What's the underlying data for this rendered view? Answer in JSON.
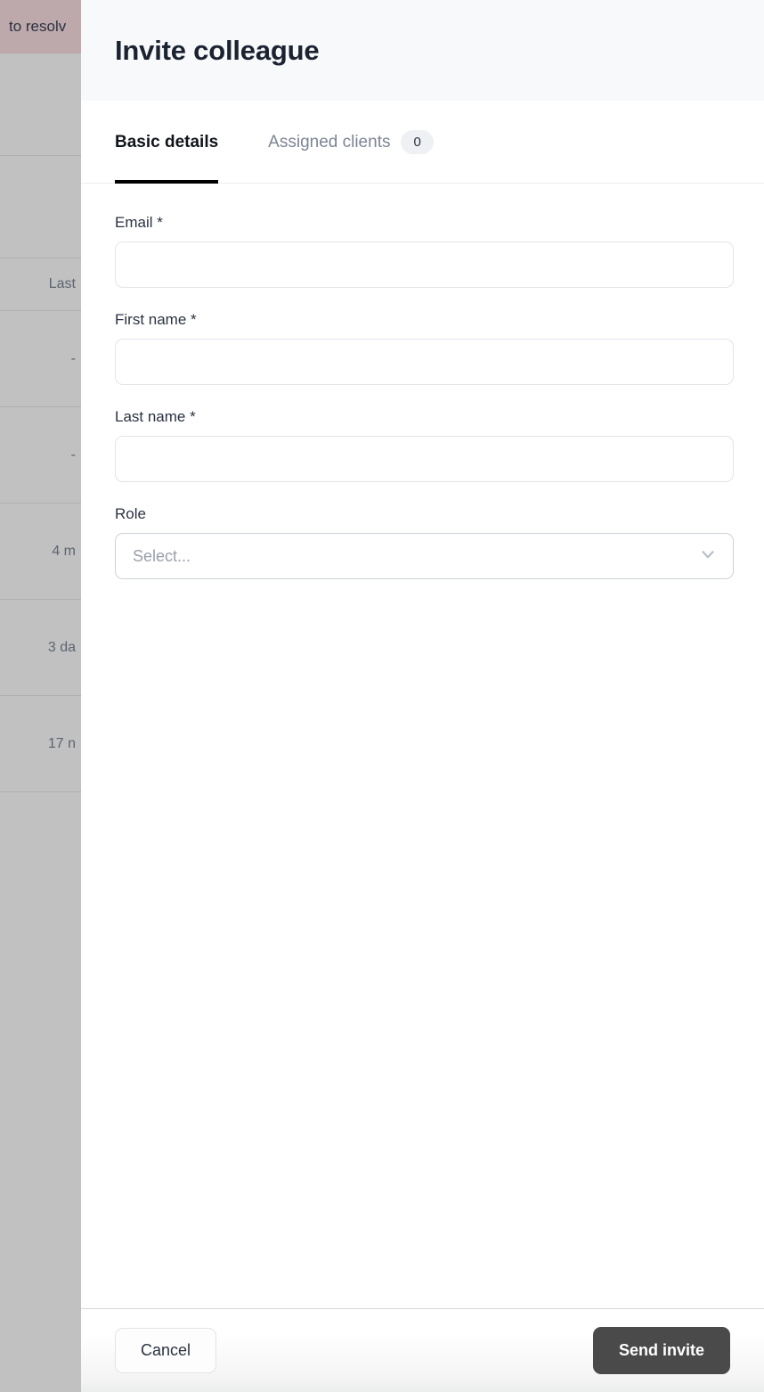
{
  "backdrop": {
    "banner_text": "to resolv",
    "rows": [
      {
        "text": ""
      },
      {
        "text": ""
      },
      {
        "text": "Last"
      },
      {
        "text": "-"
      },
      {
        "text": "-"
      },
      {
        "text": "4 m"
      },
      {
        "text": "3 da"
      },
      {
        "text": "17 n"
      }
    ]
  },
  "panel": {
    "title": "Invite colleague",
    "tabs": [
      {
        "label": "Basic details",
        "badge": null,
        "active": true
      },
      {
        "label": "Assigned clients",
        "badge": "0",
        "active": false
      }
    ],
    "fields": [
      {
        "label": "Email *",
        "value": "",
        "placeholder": ""
      },
      {
        "label": "First name *",
        "value": "",
        "placeholder": ""
      },
      {
        "label": "Last name *",
        "value": "",
        "placeholder": ""
      }
    ],
    "role": {
      "label": "Role",
      "placeholder": "Select...",
      "icon": "chevron-down-icon"
    },
    "footer": {
      "cancel_label": "Cancel",
      "submit_label": "Send invite"
    }
  },
  "colors": {
    "header_bg": "#f8f9fb",
    "panel_bg": "#ffffff",
    "active_tab_underline": "#000000",
    "primary_button_bg": "#4a4a4a",
    "backdrop_dim": "#c1c1c1",
    "banner_bg": "#bda8ab",
    "badge_bg": "#eef0f3"
  }
}
